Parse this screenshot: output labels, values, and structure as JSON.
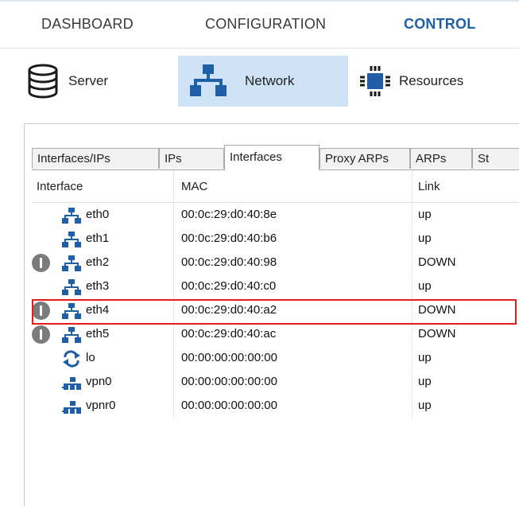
{
  "menu": {
    "items": [
      {
        "label": "DASHBOARD",
        "active": false
      },
      {
        "label": "CONFIGURATION",
        "active": false
      },
      {
        "label": "CONTROL",
        "active": true
      }
    ]
  },
  "toolbar": {
    "buttons": [
      {
        "label": "Server",
        "icon": "database-icon",
        "selected": false
      },
      {
        "label": "Network",
        "icon": "network-icon",
        "selected": true
      },
      {
        "label": "Resources",
        "icon": "chip-icon",
        "selected": false
      }
    ]
  },
  "tabs": [
    "Interfaces/IPs",
    "IPs",
    "Interfaces",
    "Proxy ARPs",
    "ARPs",
    "St"
  ],
  "active_tab": "Interfaces",
  "table": {
    "columns": [
      "Interface",
      "MAC",
      "Link"
    ],
    "rows": [
      {
        "interface": "eth0",
        "mac": "00:0c:29:d0:40:8e",
        "link": "up",
        "warning": false,
        "icon": "network-icon",
        "highlighted": false
      },
      {
        "interface": "eth1",
        "mac": "00:0c:29:d0:40:b6",
        "link": "up",
        "warning": false,
        "icon": "network-icon",
        "highlighted": false
      },
      {
        "interface": "eth2",
        "mac": "00:0c:29:d0:40:98",
        "link": "DOWN",
        "warning": true,
        "icon": "network-icon",
        "highlighted": false
      },
      {
        "interface": "eth3",
        "mac": "00:0c:29:d0:40:c0",
        "link": "up",
        "warning": false,
        "icon": "network-icon",
        "highlighted": true
      },
      {
        "interface": "eth4",
        "mac": "00:0c:29:d0:40:a2",
        "link": "DOWN",
        "warning": true,
        "icon": "network-icon",
        "highlighted": false
      },
      {
        "interface": "eth5",
        "mac": "00:0c:29:d0:40:ac",
        "link": "DOWN",
        "warning": true,
        "icon": "network-icon",
        "highlighted": false
      },
      {
        "interface": "lo",
        "mac": "00:00:00:00:00:00",
        "link": "up",
        "warning": false,
        "icon": "loopback-icon",
        "highlighted": false
      },
      {
        "interface": "vpn0",
        "mac": "00:00:00:00:00:00",
        "link": "up",
        "warning": false,
        "icon": "vpn-icon",
        "highlighted": false
      },
      {
        "interface": "vpnr0",
        "mac": "00:00:00:00:00:00",
        "link": "up",
        "warning": false,
        "icon": "vpn-icon",
        "highlighted": false
      }
    ]
  },
  "colors": {
    "accent": "#1f5fa8",
    "selected_bg": "#cfe3f7",
    "highlight_border": "#e31b1b",
    "warning_icon": "#7b7b7b",
    "network_icon": "#1f5fa8"
  }
}
